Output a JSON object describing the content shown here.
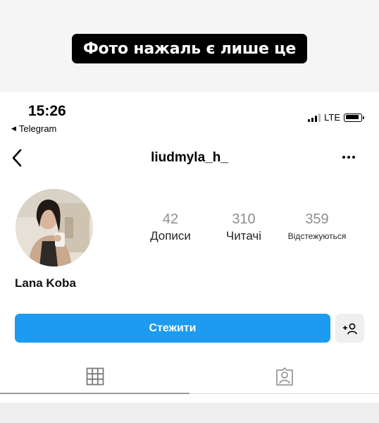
{
  "caption": "Фото нажаль є лише це",
  "status_bar": {
    "time": "15:26",
    "back_app": "Telegram",
    "network": "LTE"
  },
  "nav": {
    "username": "liudmyla_h_",
    "back_icon": "chevron-left-icon",
    "more_icon": "more-horizontal-icon"
  },
  "profile": {
    "display_name": "Lana Koba",
    "stats": [
      {
        "value": "42",
        "label": "Дописи"
      },
      {
        "value": "310",
        "label": "Читачі"
      },
      {
        "value": "359",
        "label": "Відстежуються"
      }
    ]
  },
  "actions": {
    "follow_label": "Стежити",
    "suggest_icon": "add-person-icon"
  },
  "tabs": [
    {
      "icon": "grid-icon",
      "active": true
    },
    {
      "icon": "tagged-person-icon",
      "active": false
    }
  ],
  "colors": {
    "accent": "#1c9bf0",
    "caption_bg": "#000000",
    "muted_text": "#8e8e8e"
  }
}
